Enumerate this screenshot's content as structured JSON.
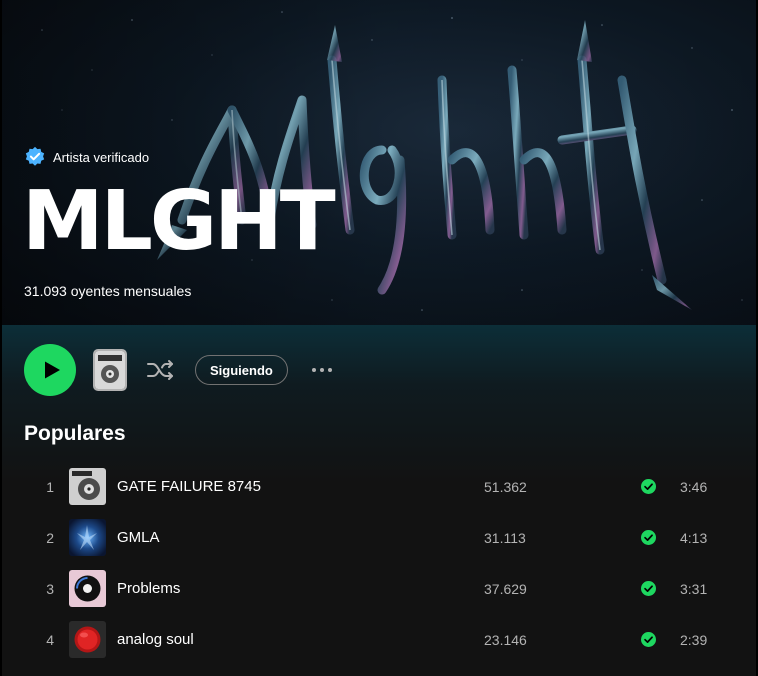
{
  "header": {
    "verified_label": "Artista verificado",
    "artist_name": "MLGHT",
    "monthly_listeners": "31.093 oyentes mensuales",
    "logo_text": "mlghht"
  },
  "controls": {
    "play_icon": "play-icon",
    "shuffle_icon": "shuffle-icon",
    "follow_label": "Siguiendo",
    "more_icon": "more-icon"
  },
  "popular": {
    "title": "Populares",
    "tracks": [
      {
        "number": "1",
        "title": "GATE FAILURE 8745",
        "plays": "51.362",
        "duration": "3:46"
      },
      {
        "number": "2",
        "title": "GMLA",
        "plays": "31.113",
        "duration": "4:13"
      },
      {
        "number": "3",
        "title": "Problems",
        "plays": "37.629",
        "duration": "3:31"
      },
      {
        "number": "4",
        "title": "analog soul",
        "plays": "23.146",
        "duration": "2:39"
      }
    ]
  },
  "colors": {
    "accent": "#1ed760",
    "background": "#121212",
    "verified_blue": "#4cb3ff"
  }
}
